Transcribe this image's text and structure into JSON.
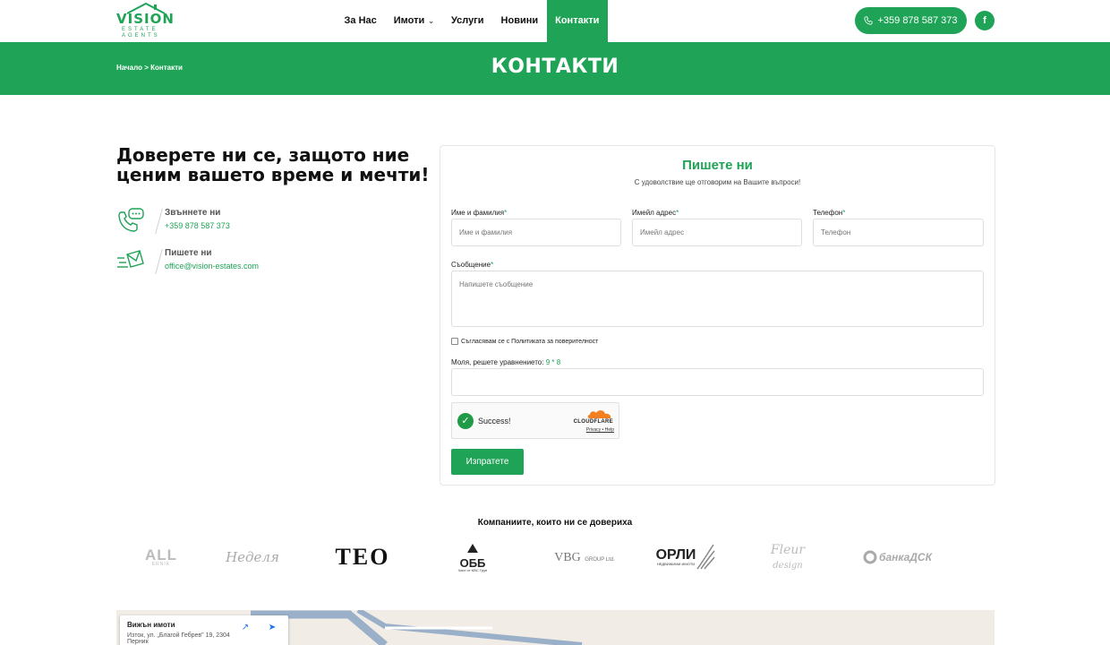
{
  "header": {
    "logo_word": "VISION",
    "logo_sub1": "ESTATE",
    "logo_sub2": "AGENTS",
    "nav": [
      {
        "label": "За Нас"
      },
      {
        "label": "Имоти"
      },
      {
        "label": "Услуги"
      },
      {
        "label": "Новини"
      },
      {
        "label": "Контакти"
      }
    ],
    "phone": "+359 878 587 373",
    "facebook": "f"
  },
  "banner": {
    "breadcrumb": "Начало > Контакти",
    "title": "КОНТАКТИ"
  },
  "intro": {
    "headline": "Доверете ни се, защото ние ценим вашето време и мечти!",
    "call_label": "Звъннете ни",
    "call_value": "+359 878 587 373",
    "mail_label": "Пишете ни",
    "mail_value": "office@vision-estates.com"
  },
  "form": {
    "title": "Пишете ни",
    "subtitle": "С удоволствие ще отговорим на Вашите въпроси!",
    "name_label": "Име и фамилия",
    "name_placeholder": "Име и фамилия",
    "email_label": "Имейл адрес",
    "email_placeholder": "Имейл адрес",
    "phone_label": "Телефон",
    "phone_placeholder": "Телефон",
    "message_label": "Съобщение",
    "message_placeholder": "Напишете съобщение",
    "required_mark": "*",
    "consent": "Съгласявам се с Политиката за поверителност",
    "equation_label": "Моля, решете уравнението:",
    "equation_value": "9 * 8",
    "captcha_status": "Success!",
    "captcha_brand": "CLOUDFLARE",
    "captcha_links": "Privacy  •  Help",
    "submit": "Изпратете"
  },
  "partners": {
    "title": "Компаниите, които ни се довериха",
    "logos": [
      {
        "text": "ALL",
        "sub": "ERNIK"
      },
      {
        "text": "Неделя"
      },
      {
        "text": "TEO"
      },
      {
        "text": "ОББ",
        "sub": "Част от KBC Груп"
      },
      {
        "text": "VBG",
        "sub": "GROUP Ltd."
      },
      {
        "text": "ОРЛИ",
        "sub": "НЕДВИЖИМИ ИМОТИ"
      },
      {
        "text": "Fleur",
        "sub": "design"
      },
      {
        "text": "банкаДСК"
      }
    ]
  },
  "map": {
    "title": "Вижън имоти",
    "address": "Изток, ул. „Благой Гебрев\" 19, 2304 Перник"
  },
  "colors": {
    "accent": "#1fa356"
  }
}
